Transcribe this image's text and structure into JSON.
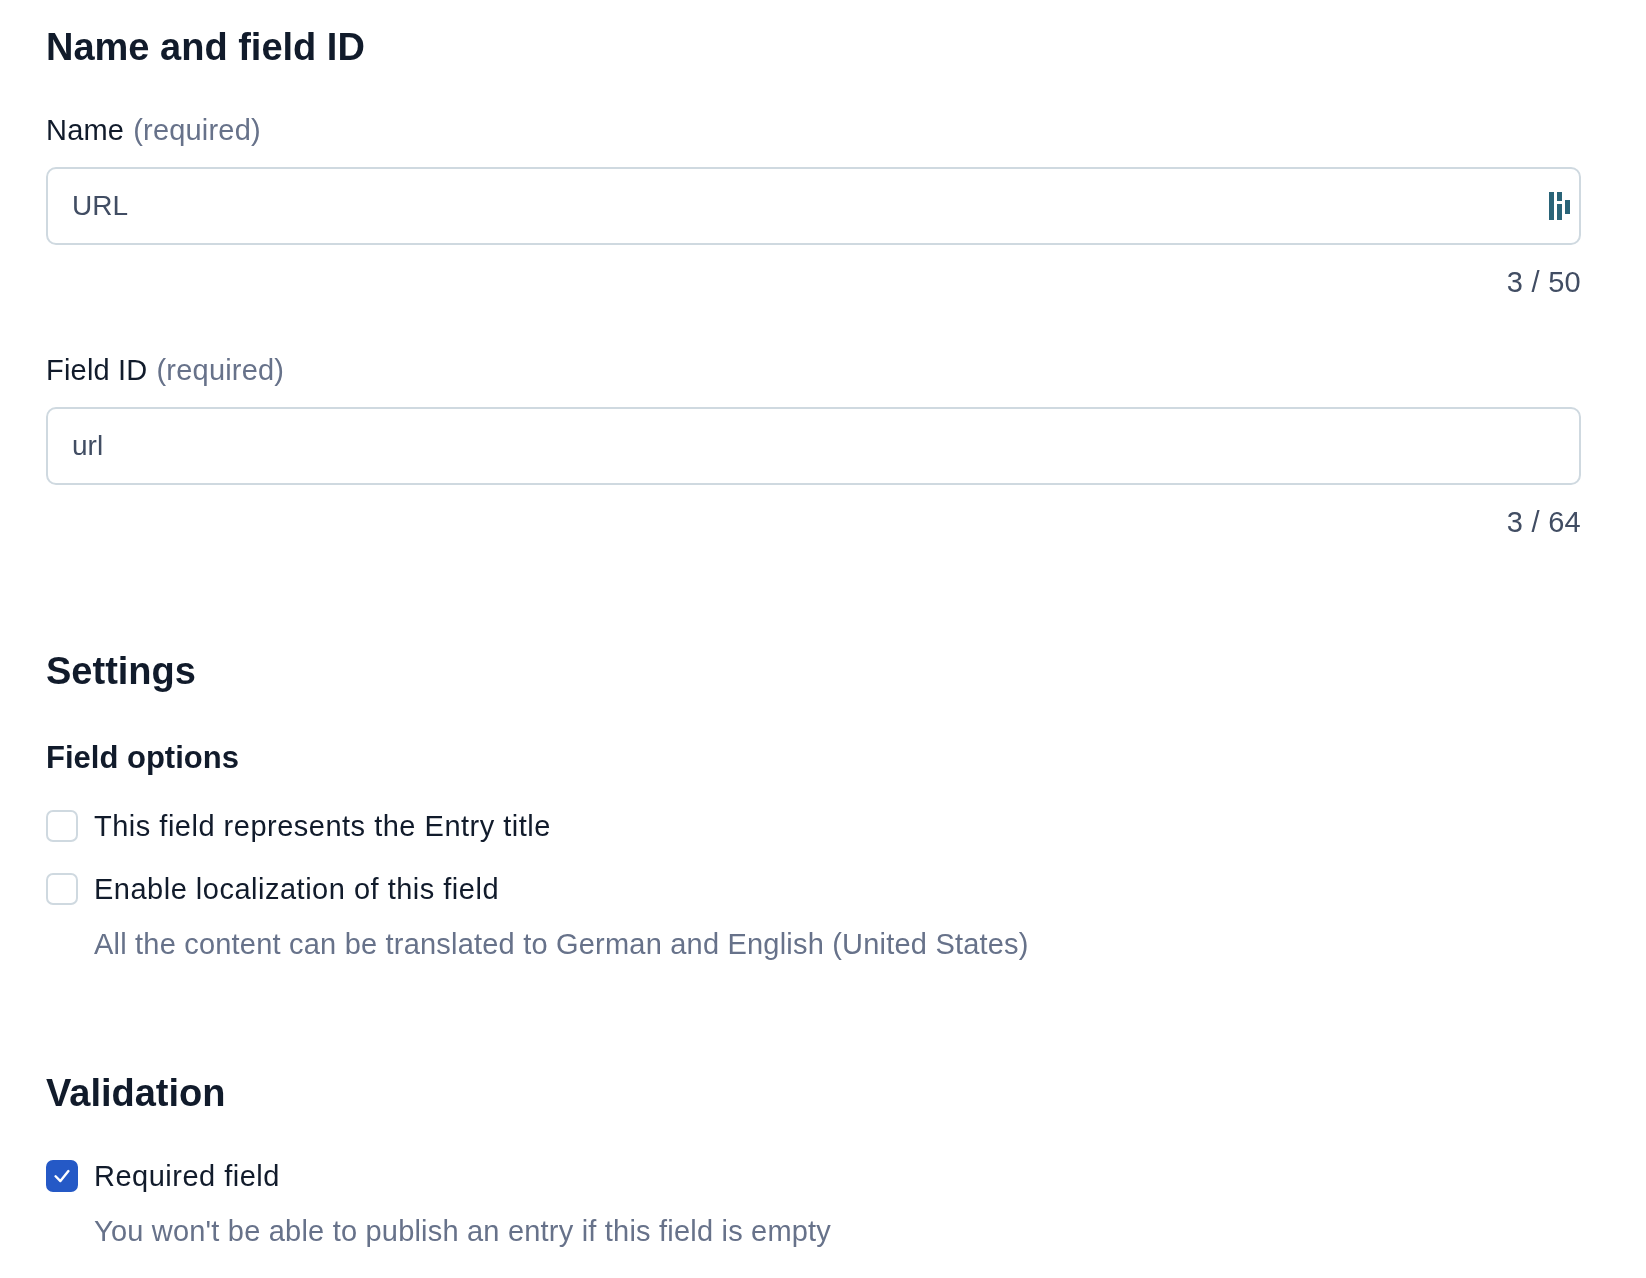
{
  "name_section": {
    "heading": "Name and field ID",
    "fields": [
      {
        "kind": "text-with-icon",
        "label": "Name",
        "hint": "(required)",
        "value": "URL",
        "counter": "3 / 50"
      },
      {
        "kind": "text",
        "label": "Field ID",
        "hint": "(required)",
        "value": "url",
        "counter": "3 / 64"
      }
    ]
  },
  "settings": {
    "heading": "Settings",
    "subheading": "Field options",
    "options": [
      {
        "label": "This field represents the Entry title",
        "checked": false
      },
      {
        "label": "Enable localization of this field",
        "checked": false,
        "help": "All the content can be translated to German and English (United States)"
      }
    ]
  },
  "validation": {
    "heading": "Validation",
    "options": [
      {
        "label": "Required field",
        "checked": true,
        "help": "You won't be able to publish an entry if this field is empty"
      }
    ]
  }
}
